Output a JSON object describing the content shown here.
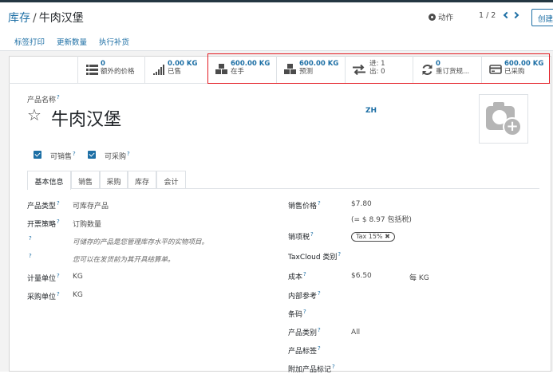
{
  "breadcrumb": {
    "parent": "库存",
    "separator": "/",
    "current": "牛肉汉堡"
  },
  "toolbar": {
    "action_label": "动作",
    "pager": "1 / 2",
    "create_label": "创建"
  },
  "header_buttons": [
    "标签打印",
    "更新数量",
    "执行补货"
  ],
  "stat_buttons": [
    {
      "icon": "list-icon",
      "value": "0",
      "label": "额外的价格"
    },
    {
      "icon": "bar-chart-icon",
      "value": "0.00 KG",
      "label": "已售"
    },
    {
      "icon": "cubes-icon",
      "value": "600.00 KG",
      "label": "在手"
    },
    {
      "icon": "cubes-icon",
      "value": "600.00 KG",
      "label": "预测"
    },
    {
      "icon": "exchange-icon",
      "value": "进: 1",
      "label": "出: 0"
    },
    {
      "icon": "refresh-icon",
      "value": "0",
      "label": "重订货规..."
    },
    {
      "icon": "credit-card-icon",
      "value": "600.00 KG",
      "label": "已采购"
    }
  ],
  "product": {
    "name_label": "产品名称",
    "name": "牛肉汉堡",
    "lang": "ZH"
  },
  "checkboxes": {
    "can_be_sold": "可销售",
    "can_be_purchased": "可采购"
  },
  "tabs": [
    "基本信息",
    "销售",
    "采购",
    "库存",
    "会计"
  ],
  "left_fields": {
    "type_label": "产品类型",
    "type_value": "可库存产品",
    "invoice_label": "开票策略",
    "invoice_value": "订购数量",
    "help1": "可储存的产品是您管理库存水平的实物项目。",
    "help2": "您可以在发货前为其开具结算单。",
    "uom_label": "计量单位",
    "uom_value": "KG",
    "purchase_uom_label": "采购单位",
    "purchase_uom_value": "KG"
  },
  "right_fields": {
    "sales_price_label": "销售价格",
    "sales_price_value": "$7.80",
    "incl_tax": "(= $ 8.97 包括税)",
    "sales_tax_label": "销项税",
    "sales_tax_badge": "Tax 15%",
    "taxcloud_label": "TaxCloud 类别",
    "cost_label": "成本",
    "cost_value": "$6.50",
    "cost_unit": "每 KG",
    "internal_ref_label": "内部参考",
    "barcode_label": "条码",
    "category_label": "产品类别",
    "category_value": "All",
    "tags_label": "产品标签",
    "attached_label": "附加产品标记"
  }
}
